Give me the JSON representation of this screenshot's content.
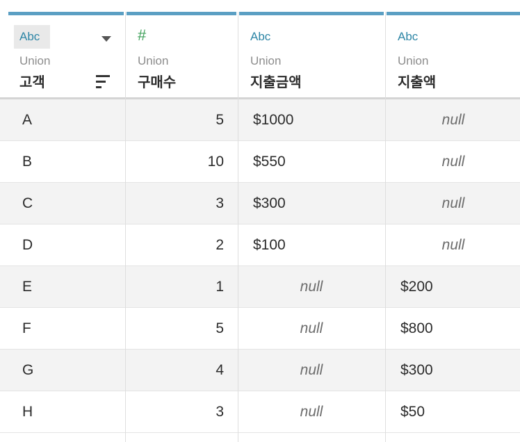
{
  "columns": [
    {
      "type_label": "Abc",
      "source": "Union",
      "name": "고객"
    },
    {
      "type_label": "#",
      "source": "Union",
      "name": "구매수"
    },
    {
      "type_label": "Abc",
      "source": "Union",
      "name": "지출금액"
    },
    {
      "type_label": "Abc",
      "source": "Union",
      "name": "지출액"
    }
  ],
  "rows": [
    {
      "customer": "A",
      "count": "5",
      "amount": "$1000",
      "spend": "null"
    },
    {
      "customer": "B",
      "count": "10",
      "amount": "$550",
      "spend": "null"
    },
    {
      "customer": "C",
      "count": "3",
      "amount": "$300",
      "spend": "null"
    },
    {
      "customer": "D",
      "count": "2",
      "amount": "$100",
      "spend": "null"
    },
    {
      "customer": "E",
      "count": "1",
      "amount": "null",
      "spend": "$200"
    },
    {
      "customer": "F",
      "count": "5",
      "amount": "null",
      "spend": "$800"
    },
    {
      "customer": "G",
      "count": "4",
      "amount": "null",
      "spend": "$300"
    },
    {
      "customer": "H",
      "count": "3",
      "amount": "null",
      "spend": "$50"
    }
  ],
  "colors": {
    "header_accent": "#5b9fc3",
    "string_type": "#2e86a6",
    "number_type": "#3fa05a",
    "alt_row": "#f3f3f3"
  },
  "icons": {
    "type_dropdown": "chevron-down-icon",
    "sort": "sort-icon",
    "number_type": "hash-icon"
  }
}
